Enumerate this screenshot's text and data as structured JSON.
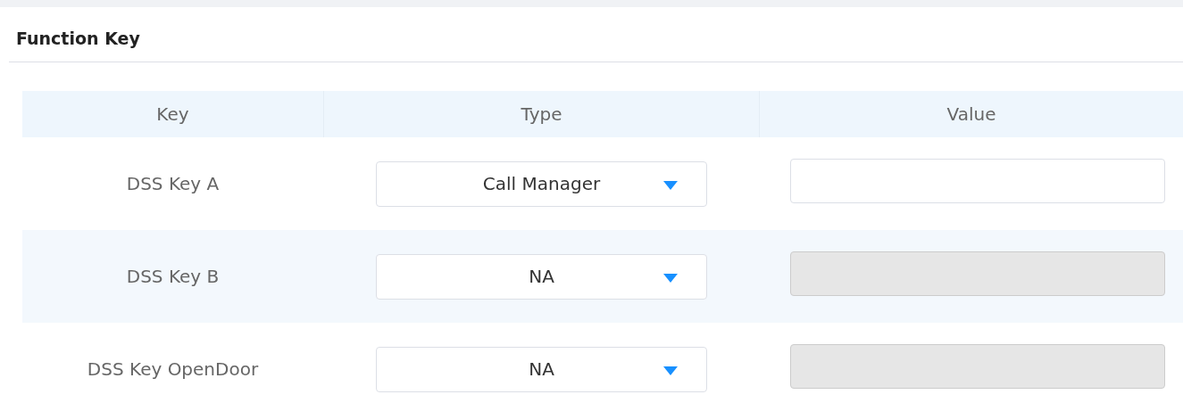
{
  "section": {
    "title": "Function Key"
  },
  "table": {
    "columns": [
      "Key",
      "Type",
      "Value"
    ],
    "rows": [
      {
        "key": "DSS Key A",
        "type": "Call Manager",
        "value_disabled": false
      },
      {
        "key": "DSS Key B",
        "type": "NA",
        "value_disabled": true
      },
      {
        "key": "DSS Key OpenDoor",
        "type": "NA",
        "value_disabled": true
      }
    ]
  }
}
